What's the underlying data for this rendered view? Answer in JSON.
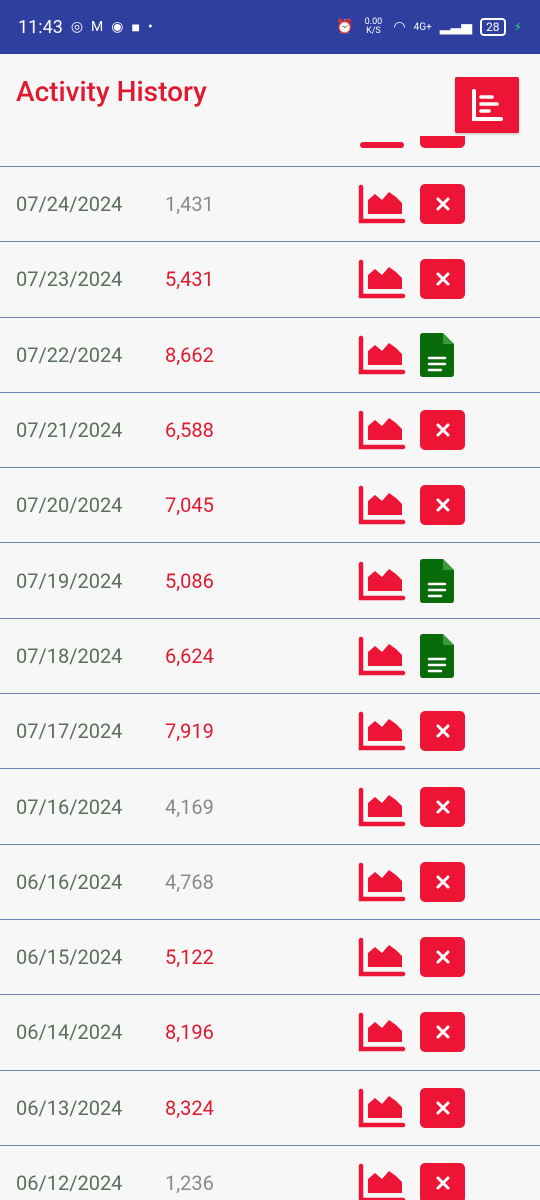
{
  "status_bar": {
    "time": "11:43",
    "data_speed": "0.00 K/S",
    "network": "4G+",
    "battery": "28"
  },
  "header": {
    "title": "Activity History",
    "menu_icon": "list-icon"
  },
  "colors": {
    "accent_red": "#ee1436",
    "doc_green": "#0a6b0a",
    "status_bar": "#2f3f9f"
  },
  "rows": [
    {
      "date": "07/24/2024",
      "value": "1,431",
      "value_color": "grey",
      "action": "delete"
    },
    {
      "date": "07/23/2024",
      "value": "5,431",
      "value_color": "red",
      "action": "delete"
    },
    {
      "date": "07/22/2024",
      "value": "8,662",
      "value_color": "red",
      "action": "document"
    },
    {
      "date": "07/21/2024",
      "value": "6,588",
      "value_color": "red",
      "action": "delete"
    },
    {
      "date": "07/20/2024",
      "value": "7,045",
      "value_color": "red",
      "action": "delete"
    },
    {
      "date": "07/19/2024",
      "value": "5,086",
      "value_color": "red",
      "action": "document"
    },
    {
      "date": "07/18/2024",
      "value": "6,624",
      "value_color": "red",
      "action": "document"
    },
    {
      "date": "07/17/2024",
      "value": "7,919",
      "value_color": "red",
      "action": "delete"
    },
    {
      "date": "07/16/2024",
      "value": "4,169",
      "value_color": "grey",
      "action": "delete"
    },
    {
      "date": "06/16/2024",
      "value": "4,768",
      "value_color": "grey",
      "action": "delete"
    },
    {
      "date": "06/15/2024",
      "value": "5,122",
      "value_color": "red",
      "action": "delete"
    },
    {
      "date": "06/14/2024",
      "value": "8,196",
      "value_color": "red",
      "action": "delete"
    },
    {
      "date": "06/13/2024",
      "value": "8,324",
      "value_color": "red",
      "action": "delete"
    },
    {
      "date": "06/12/2024",
      "value": "1,236",
      "value_color": "grey",
      "action": "delete"
    }
  ]
}
